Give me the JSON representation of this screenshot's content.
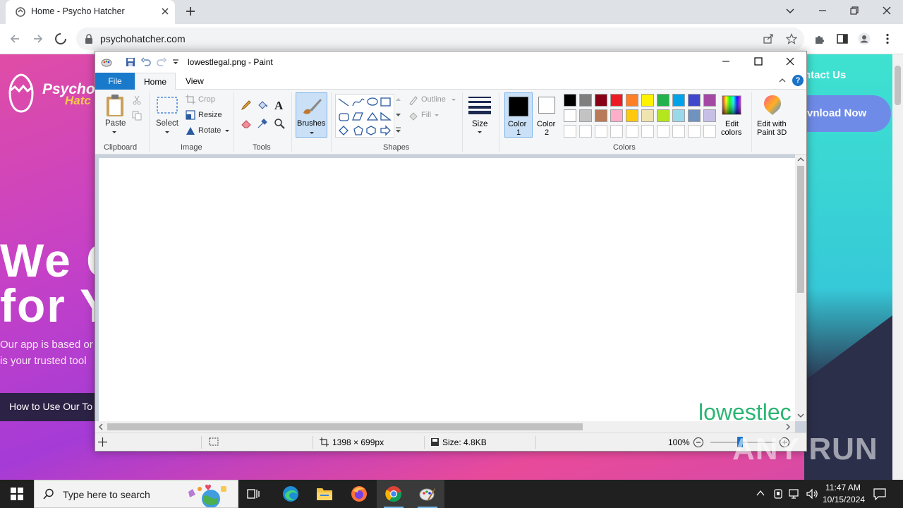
{
  "browser": {
    "tab_title": "Home - Psycho Hatcher",
    "url": "psychohatcher.com"
  },
  "website": {
    "logo_line1": "Psycho",
    "logo_line2": "Hatc",
    "nav_contact": "ntact Us",
    "download_button": "vnload Now",
    "hero_line1": "We C",
    "hero_line2": "for Y",
    "desc_line1": "Our app is based or",
    "desc_line2": "is your trusted tool",
    "cta_button": "How to Use Our To"
  },
  "paint": {
    "window_title": "lowestlegal.png - Paint",
    "tabs": {
      "file": "File",
      "home": "Home",
      "view": "View"
    },
    "help": "?",
    "clipboard": {
      "paste": "Paste",
      "label": "Clipboard"
    },
    "image": {
      "select": "Select",
      "crop": "Crop",
      "resize": "Resize",
      "rotate": "Rotate",
      "label": "Image"
    },
    "tools": {
      "label": "Tools"
    },
    "brushes": "Brushes",
    "shapes": {
      "outline": "Outline",
      "fill": "Fill",
      "label": "Shapes"
    },
    "size": "Size",
    "color1": [
      "Color",
      "1"
    ],
    "color2": [
      "Color",
      "2"
    ],
    "colors_label": "Colors",
    "edit_colors": [
      "Edit",
      "colors"
    ],
    "edit_paint3d": [
      "Edit with",
      "Paint 3D"
    ],
    "palette_row1": [
      "#000000",
      "#7f7f7f",
      "#880015",
      "#ed1c24",
      "#ff7f27",
      "#fff200",
      "#22b14c",
      "#00a2e8",
      "#3f48cc",
      "#a349a4"
    ],
    "palette_row2": [
      "#ffffff",
      "#c3c3c3",
      "#b97a57",
      "#ffaec9",
      "#ffc90e",
      "#efe4b0",
      "#b5e61d",
      "#99d9ea",
      "#7092be",
      "#c8bfe7"
    ],
    "canvas_text": "lowestlec",
    "canvas_text_color": "#2bb673",
    "status": {
      "dimensions": "1398 × 699px",
      "size": "Size: 4.8KB",
      "zoom": "100%"
    }
  },
  "taskbar": {
    "search_placeholder": "Type here to search",
    "time": "11:47 AM",
    "date": "10/15/2024"
  },
  "watermark": "ANY RUN"
}
